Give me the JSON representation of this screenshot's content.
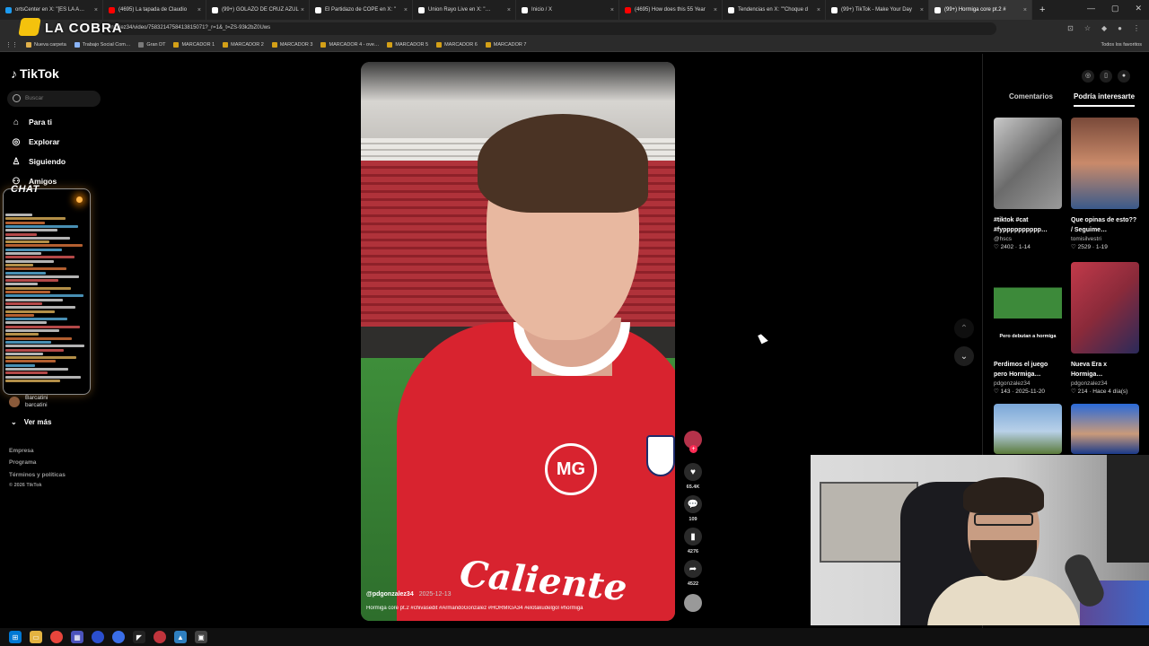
{
  "browser": {
    "tabs": [
      {
        "label": "ortsCenter en X: \"[ES LA A…",
        "color": "#1d9bf0"
      },
      {
        "label": "(4695) La tapada de Claudio",
        "color": "#ff0000"
      },
      {
        "label": "(99+) GOLAZO DE CRUZ AZUL",
        "color": "#ffffff"
      },
      {
        "label": "El Partidazo de COPE en X: \"",
        "color": "#ffffff"
      },
      {
        "label": "Union Rayo Live en X: \"…",
        "color": "#ffffff"
      },
      {
        "label": "Inicio / X",
        "color": "#ffffff"
      },
      {
        "label": "(4695) How does this 55 Year",
        "color": "#ff0000"
      },
      {
        "label": "Tendencias en X: \"\"Choque d",
        "color": "#ffffff"
      },
      {
        "label": "(99+) TikTok - Make Your Day",
        "color": "#ffffff"
      },
      {
        "label": "(99+) Hormiga core pt.2 #",
        "color": "#ffffff"
      }
    ],
    "new_tab": "+",
    "url": "onzalez34/video/7583214758413815071?_r=1&_t=ZS-93k2bZ0Uws",
    "bookmarks": [
      "Nueva carpeta",
      "Trabajo Social Com…",
      "Gran DT",
      "MARCADOR 1",
      "MARCADOR 2",
      "MARCADOR 3",
      "MARCADOR 4 - ove…",
      "MARCADOR 5",
      "MARCADOR 6",
      "MARCADOR 7"
    ],
    "all_bookmarks": "Todos los favoritos"
  },
  "overlay_logo": "LA COBRA",
  "sidebar": {
    "logo": "TikTok",
    "search_placeholder": "Buscar",
    "nav": [
      {
        "label": "Para ti",
        "icon": "home-icon",
        "glyph": "⌂"
      },
      {
        "label": "Explorar",
        "icon": "compass-icon",
        "glyph": "◎"
      },
      {
        "label": "Siguiendo",
        "icon": "following-icon",
        "glyph": "♙"
      },
      {
        "label": "Amigos",
        "icon": "friends-icon",
        "glyph": "⚇"
      }
    ],
    "chat_title": "CHAT",
    "following_user": {
      "name": "Barcatini",
      "handle": "barcatini"
    },
    "see_more": "Ver más",
    "footer": [
      "Empresa",
      "Programa",
      "Términos y políticas",
      "© 2026 TikTok"
    ]
  },
  "video": {
    "username": "@pdgonzalez34",
    "date": "2025-12-13",
    "caption": "Hormiga core pt.2 #chivasedit #ArmandoGonzalez #HORMIGA34 #elotakudelgol #hormiga",
    "sponsor": "Caliente",
    "logo_text": "MG"
  },
  "actions": {
    "likes": "65.4K",
    "comments": "109",
    "saves": "4276",
    "shares": "4522"
  },
  "right_panel": {
    "tabs": [
      "Comentarios",
      "Podría interesarte"
    ],
    "active_tab": "Podría interesarte",
    "cards": [
      {
        "title": "#tiktok #cat #fypppppppppp…",
        "author": "@hscs",
        "likes": "2402",
        "date": "1-14"
      },
      {
        "title": "Que opinas de esto?? / Seguime…",
        "author": "tomisilvestri",
        "likes": "2529",
        "date": "1-19"
      },
      {
        "title": "Perdimos el juego pero Hormiga…",
        "author": "pdgonzalez34",
        "likes": "143",
        "date": "2025-11-20",
        "overlay": "Pero debutan a hormiga"
      },
      {
        "title": "Nueva Era x Hormiga…",
        "author": "pdgonzalez34",
        "likes": "214",
        "date": "Hace 4 día(s)"
      },
      {
        "title": "",
        "author": "",
        "likes": "",
        "date": ""
      },
      {
        "title": "",
        "author": "",
        "likes": "",
        "date": ""
      }
    ]
  },
  "colors": {
    "accent": "#fe2c55",
    "background": "#000000"
  }
}
